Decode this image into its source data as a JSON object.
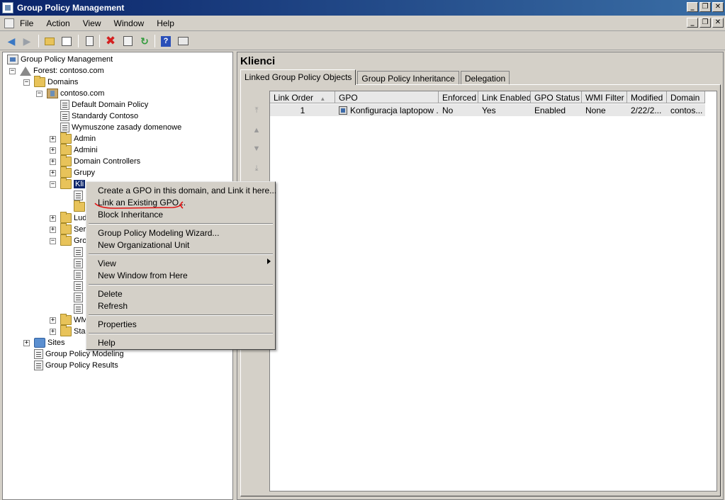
{
  "window": {
    "title": "Group Policy Management"
  },
  "window_controls": {
    "minimize": "_",
    "restore": "❐",
    "close": "✕"
  },
  "menu": {
    "items": [
      "File",
      "Action",
      "View",
      "Window",
      "Help"
    ]
  },
  "toolbar": {
    "icons": [
      "back-arrow-icon",
      "forward-arrow-icon",
      "up-folder-icon",
      "show-hide-tree-icon",
      "properties-icon",
      "delete-icon",
      "export-list-icon",
      "refresh-icon",
      "help-icon",
      "console-icon"
    ],
    "accent_colors": {
      "arrows": "#3a78c4",
      "delete": "#d42020",
      "refresh": "#2f9a3a",
      "help": "#2a4fb8"
    }
  },
  "tree": {
    "root": "Group Policy Management",
    "forest": "Forest: contoso.com",
    "domains": "Domains",
    "domain": "contoso.com",
    "gpo_links": [
      "Default Domain Policy",
      "Standardy Contoso",
      "Wymuszone zasady domenowe"
    ],
    "ous": [
      "Admin",
      "Admini",
      "Domain Controllers",
      "Grupy"
    ],
    "selected": "Klienci",
    "selected_visible": "Kli",
    "partial_items": [
      "Lud",
      "Ser",
      "Gro"
    ],
    "partial_items_2": [
      "WM",
      "Sta"
    ],
    "sites": "Sites",
    "modeling": "Group Policy Modeling",
    "results": "Group Policy Results"
  },
  "right": {
    "title": "Klienci",
    "tabs": [
      "Linked Group Policy Objects",
      "Group Policy Inheritance",
      "Delegation"
    ],
    "active_tab": 0,
    "columns": [
      "Link Order",
      "GPO",
      "Enforced",
      "Link Enabled",
      "GPO Status",
      "WMI Filter",
      "Modified",
      "Domain"
    ],
    "sort_indicator": "▲",
    "rows": [
      [
        "1",
        "Konfiguracja laptopow ...",
        "No",
        "Yes",
        "Enabled",
        "None",
        "2/22/2...",
        "contos..."
      ]
    ],
    "order_arrows": [
      "⤒",
      "▲",
      "▼",
      "⤓"
    ]
  },
  "context_menu": {
    "items": [
      "Create a GPO in this domain, and Link it here...",
      "Link an Existing GPO...",
      "Block Inheritance",
      "Group Policy Modeling Wizard...",
      "New Organizational Unit",
      "View",
      "New Window from Here",
      "Delete",
      "Refresh",
      "Properties",
      "Help"
    ],
    "annotation_color": "#e01010"
  }
}
